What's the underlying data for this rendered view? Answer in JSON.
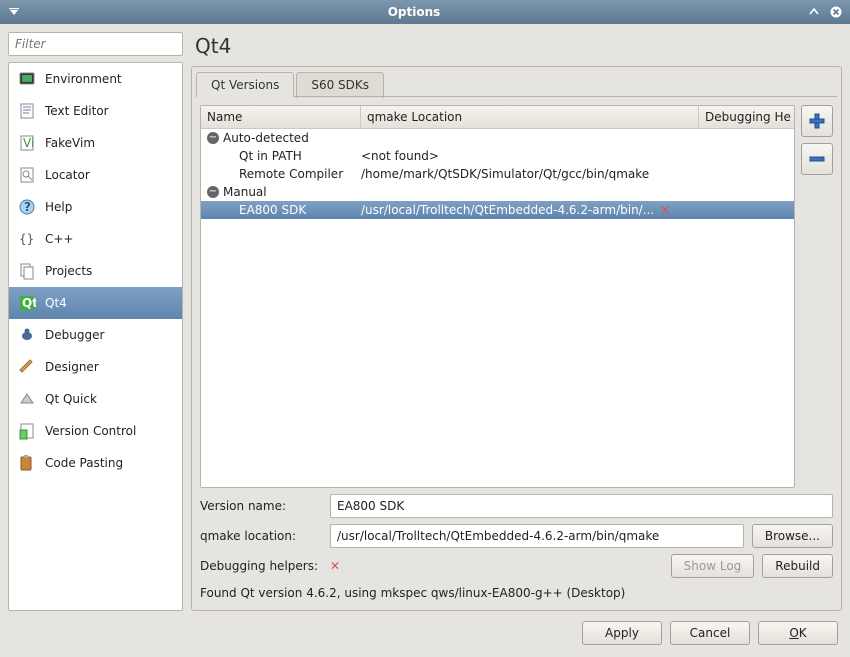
{
  "window": {
    "title": "Options"
  },
  "sidebar": {
    "filter_placeholder": "Filter",
    "items": [
      {
        "label": "Environment"
      },
      {
        "label": "Text Editor"
      },
      {
        "label": "FakeVim"
      },
      {
        "label": "Locator"
      },
      {
        "label": "Help"
      },
      {
        "label": "C++"
      },
      {
        "label": "Projects"
      },
      {
        "label": "Qt4"
      },
      {
        "label": "Debugger"
      },
      {
        "label": "Designer"
      },
      {
        "label": "Qt Quick"
      },
      {
        "label": "Version Control"
      },
      {
        "label": "Code Pasting"
      }
    ],
    "selected_index": 7
  },
  "page": {
    "title": "Qt4",
    "tabs": [
      {
        "label": "Qt Versions"
      },
      {
        "label": "S60 SDKs"
      }
    ],
    "active_tab": 0,
    "columns": {
      "name": "Name",
      "location": "qmake Location",
      "debugging": "Debugging He"
    },
    "groups": [
      {
        "label": "Auto-detected",
        "children": [
          {
            "name": "Qt in PATH",
            "location": "<not found>",
            "error": false
          },
          {
            "name": "Remote Compiler",
            "location": "/home/mark/QtSDK/Simulator/Qt/gcc/bin/qmake",
            "error": false
          }
        ]
      },
      {
        "label": "Manual",
        "children": [
          {
            "name": "EA800 SDK",
            "location": "/usr/local/Trolltech/QtEmbedded-4.6.2-arm/bin/...",
            "error": true,
            "selected": true
          }
        ]
      }
    ],
    "form": {
      "version_name_label": "Version name:",
      "version_name_value": "EA800 SDK",
      "qmake_location_label": "qmake location:",
      "qmake_location_value": "/usr/local/Trolltech/QtEmbedded-4.6.2-arm/bin/qmake",
      "browse": "Browse...",
      "debugging_helpers_label": "Debugging helpers:",
      "show_log": "Show Log",
      "rebuild": "Rebuild",
      "status": "Found Qt version 4.6.2, using mkspec qws/linux-EA800-g++ (Desktop)"
    }
  },
  "buttons": {
    "apply": "Apply",
    "cancel": "Cancel",
    "ok": "OK"
  }
}
